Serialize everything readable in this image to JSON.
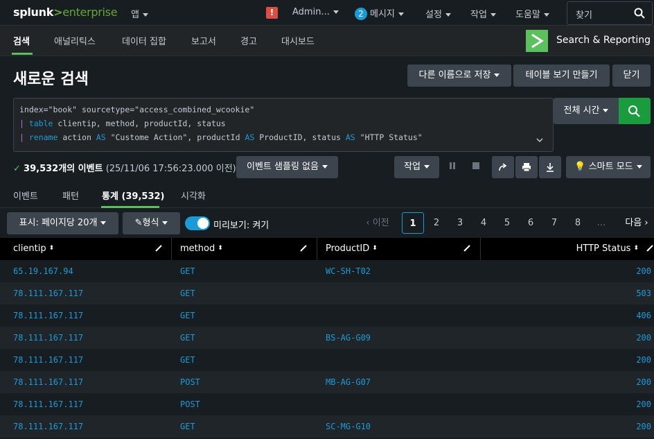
{
  "topbar": {
    "logo_splunk": "splunk",
    "logo_gt": ">",
    "logo_enterprise": "enterprise",
    "app_menu": "앱",
    "alert_icon": "!",
    "user_menu": "Admin...",
    "messages_count": "2",
    "messages_menu": "메시지",
    "settings_menu": "설정",
    "activity_menu": "작업",
    "help_menu": "도움말",
    "find_label": "찾기"
  },
  "appbar": {
    "nav": [
      "검색",
      "애널리틱스",
      "데이터 집합",
      "보고서",
      "경고",
      "대시보드"
    ],
    "app_title": "Search & Reporting"
  },
  "header": {
    "title": "새로운 검색",
    "save_as": "다른 이름으로 저장",
    "create_table_view": "테이블 보기 만들기",
    "close": "닫기"
  },
  "search": {
    "line1": "index=\"book\" sourcetype=\"access_combined_wcookie\"",
    "line2_pipe": "| ",
    "line2_cmd": "table",
    "line2_rest": " clientip, method, productId, status",
    "line3_pipe": "| ",
    "line3_cmd": "rename",
    "line3_a": " action ",
    "line3_as1": "AS",
    "line3_b": " \"Custome Action\", productId ",
    "line3_as2": "AS",
    "line3_c": " ProductID, status ",
    "line3_as3": "AS",
    "line3_d": " \"HTTP Status\"",
    "time_picker": "전체 시간"
  },
  "status": {
    "check": "✓",
    "count": "39,532개의 이벤트",
    "range": "(25/11/06 17:56:23.000 이전)",
    "sampling": "이벤트 샘플링 없음",
    "job": "작업",
    "smart_mode": "스마트 모드"
  },
  "tabs": [
    "이벤트",
    "패턴",
    "통계 (39,532)",
    "시각화"
  ],
  "results_toolbar": {
    "per_page": "표시: 페이지당 20개",
    "format": "형식",
    "preview": "미리보기: 켜기",
    "prev": "이전",
    "pages": [
      "1",
      "2",
      "3",
      "4",
      "5",
      "6",
      "7",
      "8"
    ],
    "ellipsis": "...",
    "next": "다음"
  },
  "table": {
    "columns": [
      "clientip",
      "method",
      "ProductID",
      "HTTP Status"
    ],
    "rows": [
      [
        "65.19.167.94",
        "GET",
        "WC-SH-T02",
        "200"
      ],
      [
        "78.111.167.117",
        "GET",
        "",
        "503"
      ],
      [
        "78.111.167.117",
        "GET",
        "",
        "406"
      ],
      [
        "78.111.167.117",
        "GET",
        "BS-AG-G09",
        "200"
      ],
      [
        "78.111.167.117",
        "GET",
        "",
        "200"
      ],
      [
        "78.111.167.117",
        "POST",
        "MB-AG-G07",
        "200"
      ],
      [
        "78.111.167.117",
        "POST",
        "",
        "200"
      ],
      [
        "78.111.167.117",
        "GET",
        "SC-MG-G10",
        "200"
      ]
    ]
  },
  "colors": {
    "accent_green": "#5cc05c",
    "link_blue": "#1a9bd7",
    "search_button": "#1a9c3e",
    "alert_red": "#dc4e41"
  }
}
